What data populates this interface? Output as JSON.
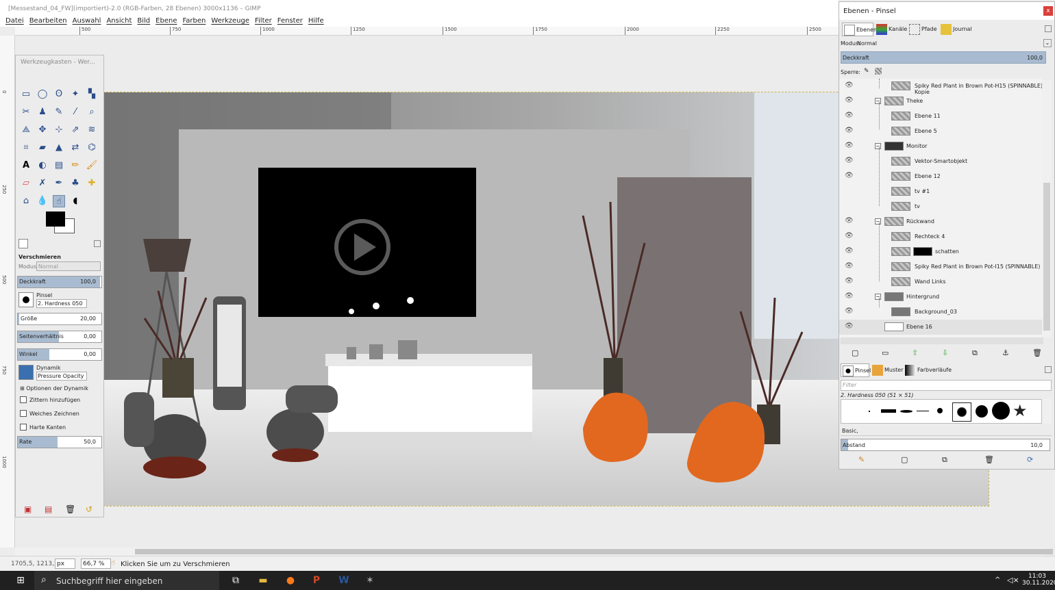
{
  "window": {
    "title": "[Messestand_04_FW](importiert)-2.0 (RGB-Farben, 28 Ebenen) 3000x1136 – GIMP"
  },
  "menu": [
    "Datei",
    "Bearbeiten",
    "Auswahl",
    "Ansicht",
    "Bild",
    "Ebene",
    "Farben",
    "Werkzeuge",
    "Filter",
    "Fenster",
    "Hilfe"
  ],
  "ruler": {
    "h_ticks": [
      "500",
      "750",
      "1000",
      "1250",
      "1500",
      "1750",
      "2000",
      "2250",
      "2500"
    ],
    "v_ticks": [
      "0",
      "250",
      "500",
      "750",
      "1000"
    ]
  },
  "toolbox": {
    "title": "Werkzeugkasten - Wer...",
    "tool_options_title": "Verschmieren",
    "mode_label": "Modus:",
    "mode_value": "Normal",
    "opacity_label": "Deckkraft",
    "opacity_value": "100,0",
    "brush_label": "Pinsel",
    "brush_value": "2. Hardness 050",
    "size_label": "Größe",
    "size_value": "20,00",
    "aspect_label": "Seitenverhältnis",
    "aspect_value": "0,00",
    "angle_label": "Winkel",
    "angle_value": "0,00",
    "dynamics_label": "Dynamik",
    "dynamics_value": "Pressure Opacity",
    "dynamics_options": "Optionen der Dynamik",
    "jitter": "Zittern hinzufügen",
    "smooth": "Weiches Zeichnen",
    "hard_edges": "Harte Kanten",
    "rate_label": "Rate",
    "rate_value": "50,0"
  },
  "dock": {
    "title": "Ebenen - Pinsel",
    "close": "x",
    "tabs": [
      "Ebenen",
      "Kanäle",
      "Pfade",
      "Journal"
    ],
    "mode_label": "Modus:",
    "mode_value": "Normal",
    "opacity_label": "Deckkraft",
    "opacity_value": "100,0",
    "lock_label": "Sperre:",
    "layers": [
      "Spiky Red Plant in Brown Pot-H15 (SPINNABLE) Kopie",
      "Theke",
      "Ebene 11",
      "Ebene 5",
      "Monitor",
      "Vektor-Smartobjekt",
      "Ebene 12",
      "tv #1",
      "tv",
      "Rückwand",
      "Rechteck 4",
      "schatten",
      "Spiky Red Plant in Brown Pot-I15 (SPINNABLE)",
      "Wand Links",
      "Hintergrund",
      "Background_03",
      "Ebene 16"
    ],
    "brush_tabs": [
      "Pinsel",
      "Muster",
      "Farbverläufe"
    ],
    "filter_placeholder": "Filter",
    "brush_info": "2. Hardness 050 (51 × 51)",
    "brush_set": "Basic,",
    "spacing_label": "Abstand",
    "spacing_value": "10,0"
  },
  "status": {
    "coords": "1705,5, 1213,5",
    "unit": "px",
    "zoom": "66,7 %",
    "message": "Klicken Sie um zu Verschmieren"
  },
  "taskbar": {
    "search_placeholder": "Suchbegriff hier eingeben",
    "time": "11:03",
    "date": "30.11.2020"
  },
  "colors": {
    "accent": "#a8bbd0",
    "taskbar": "#202020",
    "beanbag": "#e2681f",
    "close": "#d9403a"
  }
}
